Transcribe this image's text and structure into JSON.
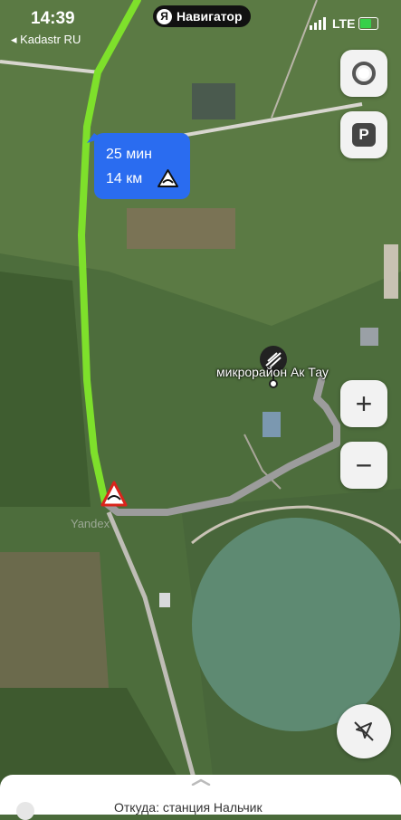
{
  "status_bar": {
    "time": "14:39",
    "back_app": "◂ Kadastr RU",
    "network": "LTE"
  },
  "app_pill": {
    "logo": "Я",
    "title": "Навигатор"
  },
  "route_bubble": {
    "duration": "25 мин",
    "distance": "14 км"
  },
  "place_label": "микрорайон Ак Тау",
  "map_watermark": "Yandex",
  "controls": {
    "parking": "P",
    "zoom_in": "+",
    "zoom_out": "−"
  },
  "bottom_sheet": {
    "from": "Откуда: станция Нальчик"
  },
  "colors": {
    "route": "#7ee02b",
    "accent": "#2a6cf0",
    "road": "#9c9c9c",
    "lake": "#5e8a72"
  }
}
